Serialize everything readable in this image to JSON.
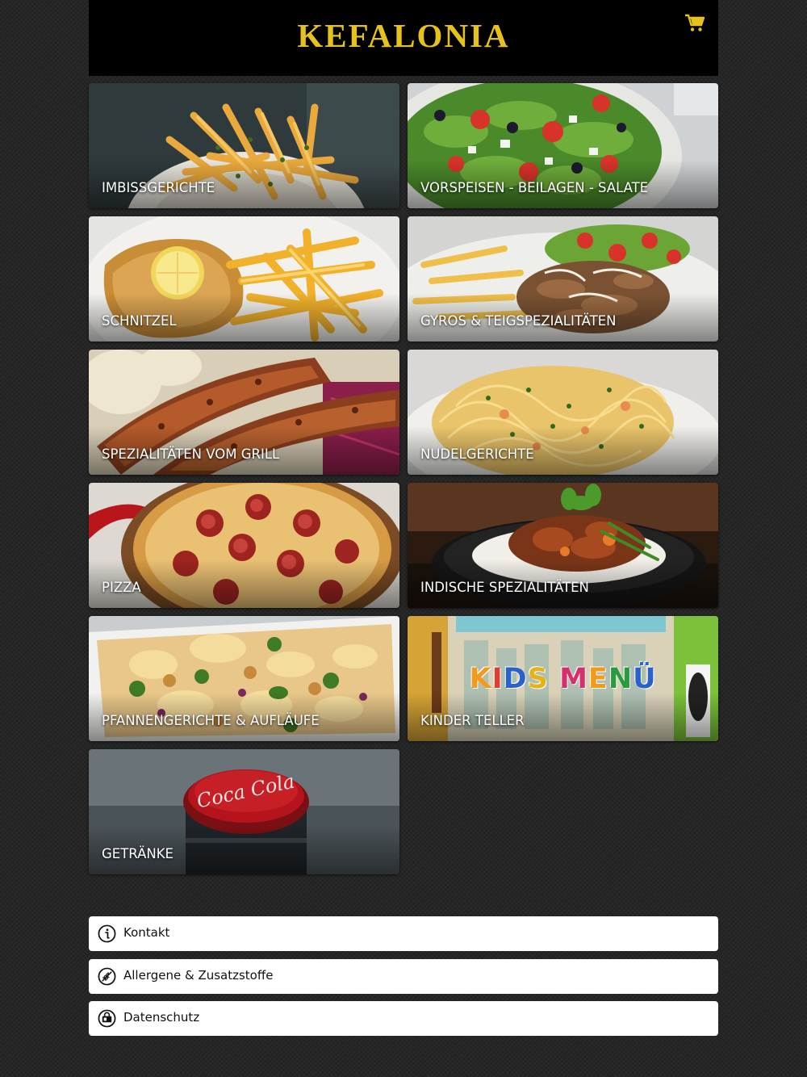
{
  "header": {
    "logo": "KEFALONIA",
    "cart_icon": "shopping-cart-icon",
    "accent_color": "#e6c21c"
  },
  "categories": [
    {
      "label": "IMBISSGERICHTE"
    },
    {
      "label": "VORSPEISEN - BEILAGEN - SALATE"
    },
    {
      "label": "SCHNITZEL"
    },
    {
      "label": "GYROS & TEIGSPEZIALITÄTEN"
    },
    {
      "label": "SPEZIALITÄTEN VOM GRILL"
    },
    {
      "label": "NUDELGERICHTE"
    },
    {
      "label": "PIZZA"
    },
    {
      "label": "INDISCHE SPEZIALITÄTEN"
    },
    {
      "label": "PFANNENGERICHTE & AUFLÄUFE"
    },
    {
      "label": "KINDER TELLER",
      "banner_text": "KIDS MENÜ"
    },
    {
      "label": "GETRÄNKE",
      "image_text": "Coca Cola"
    }
  ],
  "links": [
    {
      "label": "Kontakt",
      "icon": "info-icon"
    },
    {
      "label": "Allergene & Zusatzstoffe",
      "icon": "allergen-icon"
    },
    {
      "label": "Datenschutz",
      "icon": "privacy-icon"
    }
  ]
}
